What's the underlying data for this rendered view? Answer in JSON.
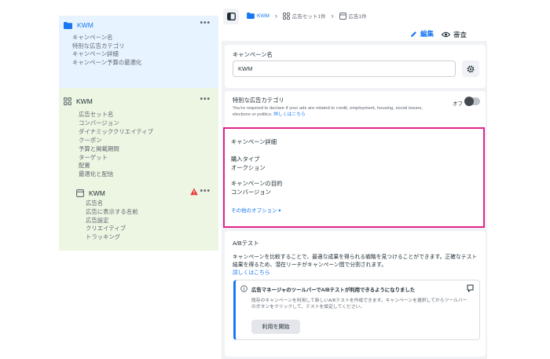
{
  "nav": {
    "campaign": {
      "title": "KWM",
      "items": [
        "キャンペーン名",
        "特別な広告カテゴリ",
        "キャンペーン詳細",
        "キャンペーン予算の最適化"
      ]
    },
    "adset": {
      "title": "KWM",
      "items": [
        "広告セット名",
        "コンバージョン",
        "ダイナミッククリエイティブ",
        "クーポン",
        "予算と掲載期間",
        "ターゲット",
        "配置",
        "最適化と配信"
      ]
    },
    "ad": {
      "title": "KWM",
      "items": [
        "広告名",
        "広告に表示する名前",
        "広告設定",
        "クリエイティブ",
        "トラッキング"
      ]
    },
    "more_label": "•••"
  },
  "breadcrumb": {
    "campaign": "KWM",
    "adset": "広告セット1件",
    "ad": "広告1件"
  },
  "tabs": {
    "edit": "編集",
    "review": "審査"
  },
  "campaign_name": {
    "label": "キャンペーン名",
    "value": "KWM"
  },
  "special_category": {
    "title": "特別な広告カテゴリ",
    "desc": "You're required to declare if your ads are related to credit, employment, housing, social issues, elections or politics.",
    "link": "詳しくはこちら",
    "toggle_label": "オフ"
  },
  "campaign_details": {
    "title": "キャンペーン詳細",
    "buy_type_label": "購入タイプ",
    "buy_type_value": "オークション",
    "objective_label": "キャンペーンの目的",
    "objective_value": "コンバージョン",
    "more_options": "その他のオプション ▾"
  },
  "ab_test": {
    "title": "A/Bテスト",
    "desc": "キャンペーンを比較することで、最適な成果を得られる戦略を見つけることができます。正確なテスト結果を得るため、潜在リーチがキャンペーン間で分割されます。",
    "link": "詳しくはこちら",
    "info_title": "広告マネージャのツールバーでA/Bテストが利用できるようになりました",
    "info_body": "既存のキャンペーンを利用して新しいA/Bテストを作成できます。キャンペーンを選択してからツールバーのボタンをクリックして、テストを設定してください。",
    "button": "利用を開始"
  },
  "colors": {
    "accent": "#1877f2",
    "highlight": "#e0238b",
    "campaign_bg": "#e7f3ff",
    "adset_bg": "#edf6e3",
    "warning": "#e4342f"
  }
}
